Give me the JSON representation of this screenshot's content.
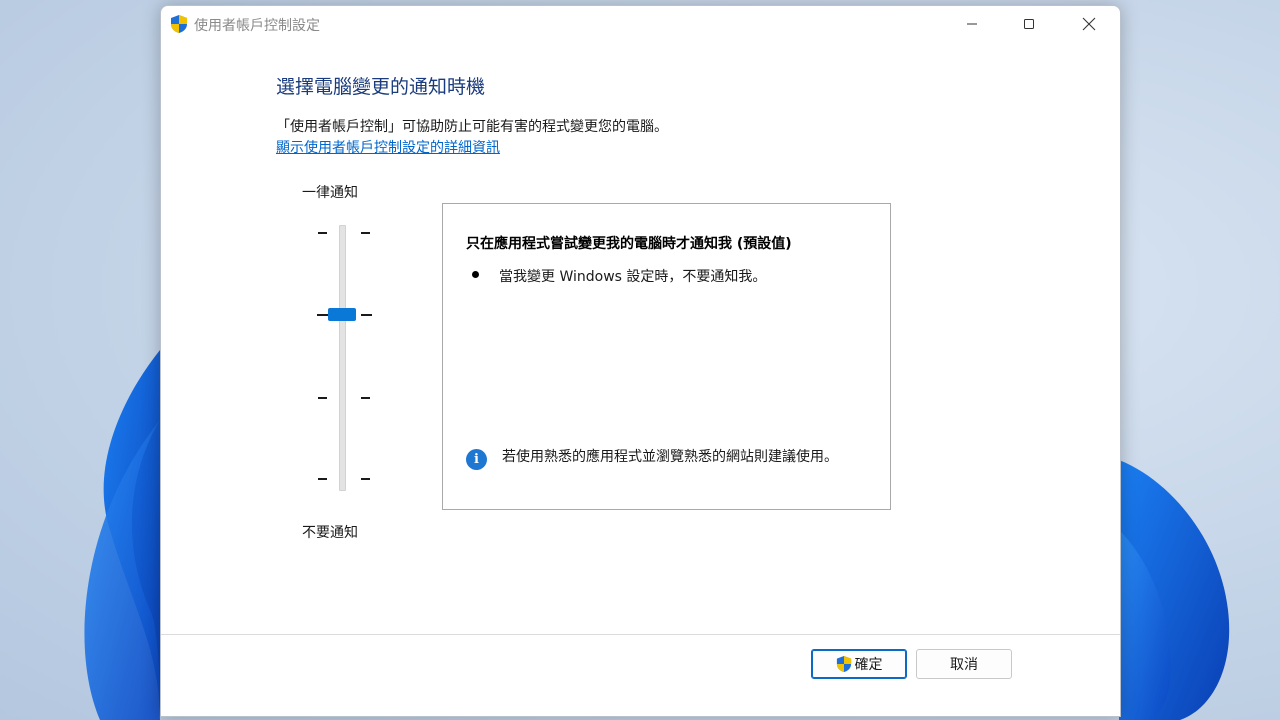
{
  "window": {
    "title": "使用者帳戶控制設定"
  },
  "main": {
    "heading": "選擇電腦變更的通知時機",
    "description": "「使用者帳戶控制」可協助防止可能有害的程式變更您的電腦。",
    "details_link": "顯示使用者帳戶控制設定的詳細資訊"
  },
  "slider": {
    "top_label": "一律通知",
    "bottom_label": "不要通知",
    "levels": 4,
    "selected_level": 3
  },
  "panel": {
    "title": "只在應用程式嘗試變更我的電腦時才通知我 (預設值)",
    "bullet": "當我變更 Windows 設定時，不要通知我。",
    "info_text": "若使用熟悉的應用程式並瀏覽熟悉的網站則建議使用。"
  },
  "buttons": {
    "ok_label": "確定",
    "cancel_label": "取消"
  },
  "colors": {
    "heading": "#1a3c7e",
    "link": "#0066cc",
    "accent": "#0a78d7",
    "info": "#1e78d2"
  }
}
